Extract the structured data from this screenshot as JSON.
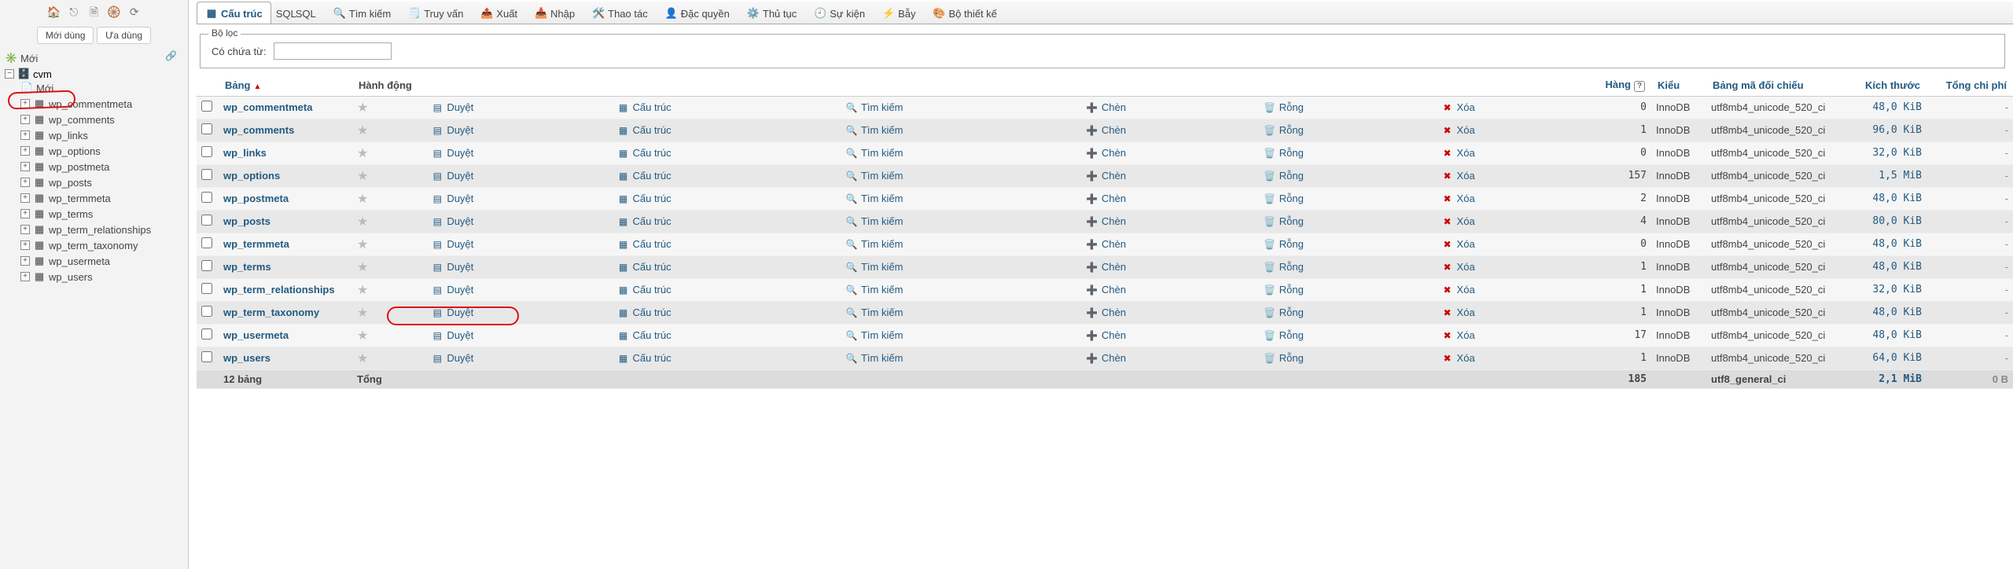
{
  "sidebar": {
    "recent_label": "Mới dùng",
    "fav_label": "Ưa dùng",
    "nodes": {
      "new": "Mới",
      "db": "cvm",
      "db_new": "Mới",
      "tables": [
        "wp_commentmeta",
        "wp_comments",
        "wp_links",
        "wp_options",
        "wp_postmeta",
        "wp_posts",
        "wp_termmeta",
        "wp_terms",
        "wp_term_relationships",
        "wp_term_taxonomy",
        "wp_usermeta",
        "wp_users"
      ]
    }
  },
  "tabs": [
    {
      "id": "structure",
      "label": "Cấu trúc",
      "active": true
    },
    {
      "id": "sql",
      "label": "SQL"
    },
    {
      "id": "search",
      "label": "Tìm kiếm"
    },
    {
      "id": "query",
      "label": "Truy vấn"
    },
    {
      "id": "export",
      "label": "Xuất"
    },
    {
      "id": "import",
      "label": "Nhập"
    },
    {
      "id": "operations",
      "label": "Thao tác"
    },
    {
      "id": "privileges",
      "label": "Đặc quyền"
    },
    {
      "id": "routines",
      "label": "Thủ tục"
    },
    {
      "id": "events",
      "label": "Sự kiện"
    },
    {
      "id": "triggers",
      "label": "Bẫy"
    },
    {
      "id": "designer",
      "label": "Bộ thiết kế"
    }
  ],
  "filter": {
    "legend": "Bộ lọc",
    "label": "Có chứa từ:",
    "value": ""
  },
  "headers": {
    "table": "Bảng",
    "action": "Hành động",
    "rows": "Hàng",
    "type": "Kiểu",
    "collation": "Bảng mã đối chiếu",
    "size": "Kích thước",
    "overhead": "Tổng chi phí"
  },
  "actions": {
    "browse": "Duyệt",
    "structure": "Cấu trúc",
    "search": "Tìm kiếm",
    "insert": "Chèn",
    "empty": "Rỗng",
    "drop": "Xóa"
  },
  "rows": [
    {
      "name": "wp_commentmeta",
      "rows": "0",
      "type": "InnoDB",
      "coll": "utf8mb4_unicode_520_ci",
      "size": "48,0 KiB",
      "over": "-"
    },
    {
      "name": "wp_comments",
      "rows": "1",
      "type": "InnoDB",
      "coll": "utf8mb4_unicode_520_ci",
      "size": "96,0 KiB",
      "over": "-"
    },
    {
      "name": "wp_links",
      "rows": "0",
      "type": "InnoDB",
      "coll": "utf8mb4_unicode_520_ci",
      "size": "32,0 KiB",
      "over": "-"
    },
    {
      "name": "wp_options",
      "rows": "157",
      "type": "InnoDB",
      "coll": "utf8mb4_unicode_520_ci",
      "size": "1,5 MiB",
      "over": "-"
    },
    {
      "name": "wp_postmeta",
      "rows": "2",
      "type": "InnoDB",
      "coll": "utf8mb4_unicode_520_ci",
      "size": "48,0 KiB",
      "over": "-"
    },
    {
      "name": "wp_posts",
      "rows": "4",
      "type": "InnoDB",
      "coll": "utf8mb4_unicode_520_ci",
      "size": "80,0 KiB",
      "over": "-"
    },
    {
      "name": "wp_termmeta",
      "rows": "0",
      "type": "InnoDB",
      "coll": "utf8mb4_unicode_520_ci",
      "size": "48,0 KiB",
      "over": "-"
    },
    {
      "name": "wp_terms",
      "rows": "1",
      "type": "InnoDB",
      "coll": "utf8mb4_unicode_520_ci",
      "size": "48,0 KiB",
      "over": "-"
    },
    {
      "name": "wp_term_relationships",
      "rows": "1",
      "type": "InnoDB",
      "coll": "utf8mb4_unicode_520_ci",
      "size": "32,0 KiB",
      "over": "-"
    },
    {
      "name": "wp_term_taxonomy",
      "rows": "1",
      "type": "InnoDB",
      "coll": "utf8mb4_unicode_520_ci",
      "size": "48,0 KiB",
      "over": "-"
    },
    {
      "name": "wp_usermeta",
      "rows": "17",
      "type": "InnoDB",
      "coll": "utf8mb4_unicode_520_ci",
      "size": "48,0 KiB",
      "over": "-"
    },
    {
      "name": "wp_users",
      "rows": "1",
      "type": "InnoDB",
      "coll": "utf8mb4_unicode_520_ci",
      "size": "64,0 KiB",
      "over": "-"
    }
  ],
  "footer": {
    "count": "12 bảng",
    "total": "Tổng",
    "rows": "185",
    "coll": "utf8_general_ci",
    "size": "2,1 MiB",
    "over": "0 B"
  }
}
